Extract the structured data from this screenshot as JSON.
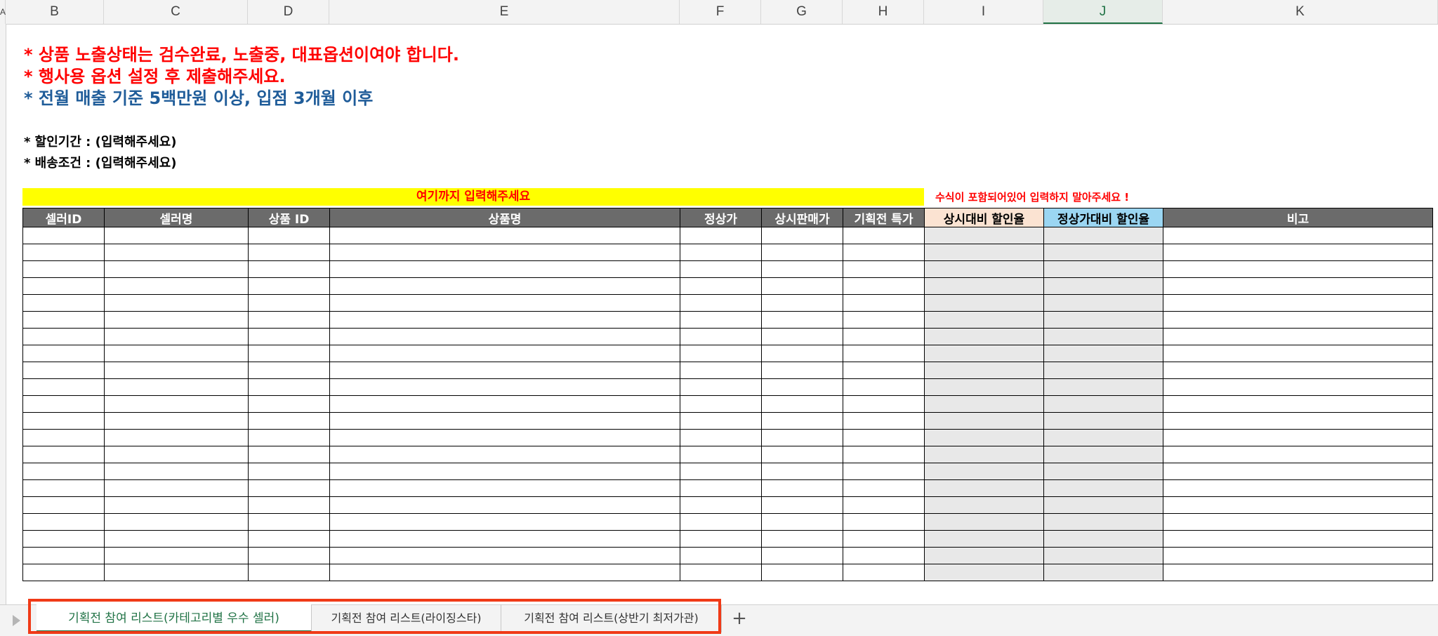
{
  "column_headers": [
    "A",
    "B",
    "C",
    "D",
    "E",
    "F",
    "G",
    "H",
    "I",
    "J",
    "K"
  ],
  "selected_column": "J",
  "notices": [
    {
      "text": "* 상품 노출상태는 검수완료, 노출중, 대표옵션이여야 합니다.",
      "color": "#ff0000"
    },
    {
      "text": "* 행사용 옵션 설정 후 제출해주세요.",
      "color": "#ff0000"
    },
    {
      "text": "* 전월 매출 기준 5백만원 이상, 입점 3개월 이후",
      "color": "#1f5c99"
    }
  ],
  "info": {
    "discount_period": "* 할인기간 : (입력해주세요)",
    "shipping_condition": "* 배송조건 : (입력해주세요)"
  },
  "input_guide": "여기까지 입력해주세요",
  "formula_note": "수식이 포함되어있어 입력하지 말아주세요 !",
  "table": {
    "headers": [
      "셀러ID",
      "셀러명",
      "상품 ID",
      "상품명",
      "정상가",
      "상시판매가",
      "기획전 특가",
      "상시대비 할인율",
      "정상가대비 할인율",
      "비고"
    ],
    "row_count": 21
  },
  "sheet_tabs": [
    {
      "label": "기획전 참여 리스트(카테고리별 우수 셀러)",
      "active": true
    },
    {
      "label": "기획전 참여 리스트(라이징스타)",
      "active": false
    },
    {
      "label": "기획전 참여 리스트(상반기 최저가관)",
      "active": false
    }
  ],
  "add_sheet_label": "+",
  "colors": {
    "accent": "#217346",
    "header_gray": "#6b6b6b",
    "highlight_yellow": "#ffff00",
    "annotation_red": "#f03a17"
  }
}
